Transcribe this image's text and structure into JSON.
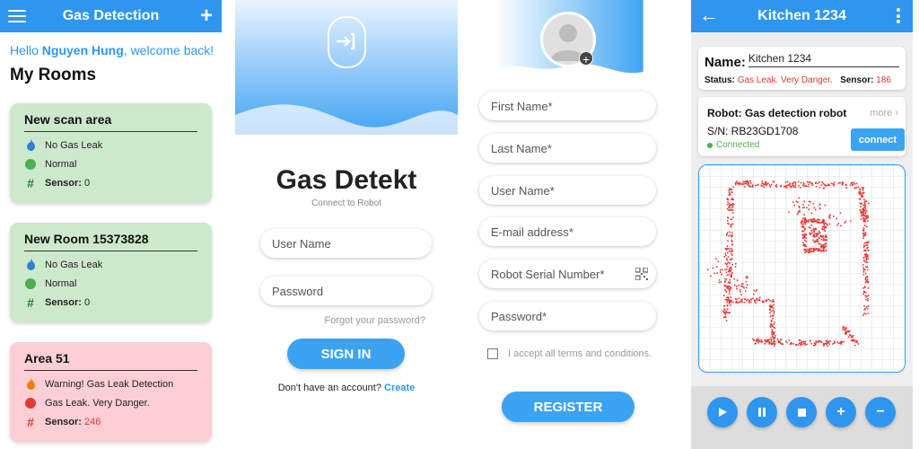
{
  "rooms_screen": {
    "title": "Gas Detection",
    "greeting_prefix": "Hello ",
    "greeting_name": "Nguyen Hung",
    "greeting_suffix": ", welcome back!",
    "heading": "My Rooms",
    "rooms": [
      {
        "name": "New scan area",
        "gas": "No Gas Leak",
        "status": "Normal",
        "sensor_label": "Sensor:",
        "sensor_value": "0",
        "alert": false
      },
      {
        "name": "New Room 15373828",
        "gas": "No Gas Leak",
        "status": "Normal",
        "sensor_label": "Sensor:",
        "sensor_value": "0",
        "alert": false
      },
      {
        "name": "Area 51",
        "gas": "Warning! Gas Leak Detection",
        "status": "Gas Leak. Very Danger.",
        "sensor_label": "Sensor:",
        "sensor_value": "246",
        "alert": true
      }
    ]
  },
  "login_screen": {
    "brand": "Gas Detekt",
    "subtitle": "Connect to Robot",
    "username_placeholder": "User Name",
    "password_placeholder": "Password",
    "forgot": "Forgot your password?",
    "signin": "SIGN IN",
    "no_account": "Don't have an account?",
    "create": "Create"
  },
  "register_screen": {
    "fields": [
      "First Name*",
      "Last Name*",
      "User Name*",
      "E-mail address*",
      "Robot Serial Number*",
      "Password*"
    ],
    "terms": "I accept all terms and conditions.",
    "register": "REGISTER"
  },
  "robot_screen": {
    "title": "Kitchen 1234",
    "name_label": "Name:",
    "name_value": "Kitchen 1234",
    "status_label": "Status:",
    "status_value": "Gas Leak. Very Danger.",
    "sensor_label": "Sensor:",
    "sensor_value": "186",
    "robot_label": "Robot: Gas detection robot",
    "more": "more",
    "serial": "S/N: RB23GD1708",
    "connected": "Connected",
    "connect_button": "connect"
  },
  "colors": {
    "primary": "#2f96f0",
    "safe_bg": "#cde9cc",
    "danger_bg": "#fbcfd3",
    "safe_dot": "#4caf50",
    "danger_dot": "#e53935",
    "map_points": "#e53935"
  },
  "icons": [
    "menu-icon",
    "add-icon",
    "flame-icon",
    "status-dot-icon",
    "hash-icon",
    "login-door-icon",
    "avatar-icon",
    "qr-code-icon",
    "back-arrow-icon",
    "more-vert-icon",
    "chevron-right-icon",
    "play-icon",
    "pause-icon",
    "stop-icon",
    "zoom-in-icon",
    "zoom-out-icon"
  ]
}
